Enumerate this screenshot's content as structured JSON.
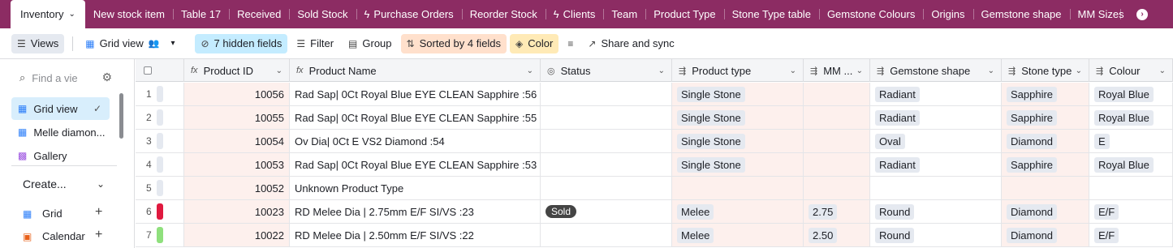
{
  "tabs": [
    {
      "label": "Inventory",
      "active": true,
      "chevron": true
    },
    {
      "label": "New stock item"
    },
    {
      "label": "Table 17"
    },
    {
      "label": "Received"
    },
    {
      "label": "Sold Stock"
    },
    {
      "label": "Purchase Orders",
      "icon": "bolt-icon"
    },
    {
      "label": "Reorder Stock"
    },
    {
      "label": "Clients",
      "icon": "bolt-icon"
    },
    {
      "label": "Team"
    },
    {
      "label": "Product Type"
    },
    {
      "label": "Stone Type table"
    },
    {
      "label": "Gemstone Colours"
    },
    {
      "label": "Origins"
    },
    {
      "label": "Gemstone shape"
    },
    {
      "label": "MM Sizes"
    }
  ],
  "toolbar": {
    "views": "Views",
    "grid_view": "Grid view",
    "hidden_fields": "7 hidden fields",
    "filter": "Filter",
    "group": "Group",
    "sorted": "Sorted by 4 fields",
    "color": "Color",
    "share": "Share and sync"
  },
  "sidebar": {
    "find_placeholder": "Find a vie",
    "views": [
      {
        "label": "Grid view",
        "active": true
      },
      {
        "label": "Melle diamon..."
      },
      {
        "label": "Gallery"
      }
    ],
    "create": "Create...",
    "new_views": [
      {
        "label": "Grid"
      },
      {
        "label": "Calendar"
      }
    ]
  },
  "grid": {
    "columns": [
      "Product ID",
      "Product Name",
      "Status",
      "Product type",
      "MM ...",
      "Gemstone shape",
      "Stone type",
      "Colour"
    ],
    "rows": [
      {
        "n": "1",
        "bar": "#e5e9f0",
        "id": "10056",
        "name": "Rad Sap| 0Ct Royal Blue EYE CLEAN Sapphire :56",
        "status": "",
        "ptype": "Single Stone",
        "mm": "",
        "shape": "Radiant",
        "stone": "Sapphire",
        "colour": "Royal Blue"
      },
      {
        "n": "2",
        "bar": "#e5e9f0",
        "id": "10055",
        "name": "Rad Sap| 0Ct Royal Blue EYE CLEAN Sapphire :55",
        "status": "",
        "ptype": "Single Stone",
        "mm": "",
        "shape": "Radiant",
        "stone": "Sapphire",
        "colour": "Royal Blue"
      },
      {
        "n": "3",
        "bar": "#e5e9f0",
        "id": "10054",
        "name": "Ov Dia| 0Ct E VS2 Diamond :54",
        "status": "",
        "ptype": "Single Stone",
        "mm": "",
        "shape": "Oval",
        "stone": "Diamond",
        "colour": "E"
      },
      {
        "n": "4",
        "bar": "#e5e9f0",
        "id": "10053",
        "name": "Rad Sap| 0Ct Royal Blue EYE CLEAN Sapphire :53",
        "status": "",
        "ptype": "Single Stone",
        "mm": "",
        "shape": "Radiant",
        "stone": "Sapphire",
        "colour": "Royal Blue"
      },
      {
        "n": "5",
        "bar": "#e5e9f0",
        "id": "10052",
        "name": "Unknown Product Type",
        "status": "",
        "ptype": "",
        "mm": "",
        "shape": "",
        "stone": "",
        "colour": ""
      },
      {
        "n": "6",
        "bar": "#e0193f",
        "id": "10023",
        "name": "RD Melee Dia | 2.75mm E/F SI/VS :23",
        "status": "Sold",
        "ptype": "Melee",
        "mm": "2.75",
        "shape": "Round",
        "stone": "Diamond",
        "colour": "E/F"
      },
      {
        "n": "7",
        "bar": "#8fe07d",
        "id": "10022",
        "name": "RD Melee Dia | 2.50mm E/F SI/VS :22",
        "status": "",
        "ptype": "Melee",
        "mm": "2.50",
        "shape": "Round",
        "stone": "Diamond",
        "colour": "E/F"
      }
    ]
  }
}
